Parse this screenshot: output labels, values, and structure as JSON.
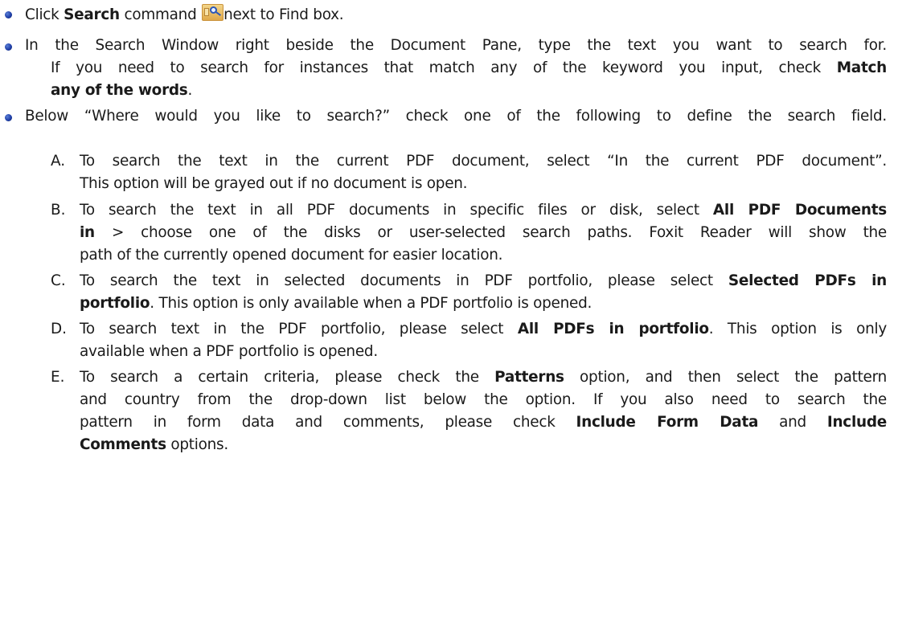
{
  "bullets": [
    {
      "pre": "Click ",
      "bold": "Search",
      "mid": " command ",
      "icon": "search-icon",
      "post": "next to Find box."
    },
    {
      "line1": "In the Search Window right beside the Document Pane, type the text you want to search for.",
      "line2_text": "If you need to search for instances that match any of the keyword you input, check ",
      "line2_bold": "Match",
      "line3_bold": "any of the words",
      "line3_text": "."
    },
    {
      "line1": "Below “Where would you like to search?” check one of the following to define the search field."
    }
  ],
  "options": [
    {
      "marker": "A.",
      "line1": "To search the text in the current PDF document, select “In the current PDF document”.",
      "line2": "This option will be grayed out if no document is open."
    },
    {
      "marker": "B.",
      "line1_text": "To search the text in all PDF documents in specific files or disk, select ",
      "line1_bold": "All PDF Documents",
      "line2_bold": "in",
      "line2_text": " > choose one of the disks or user-selected search paths. Foxit Reader will show the",
      "line3": "path of the currently opened document for easier location."
    },
    {
      "marker": "C.",
      "line1_text": "To search the text in selected documents in PDF portfolio, please select ",
      "line1_bold": "Selected PDFs in",
      "line2_bold": "portfolio",
      "line2_text": ". This option is only available when a PDF portfolio is opened."
    },
    {
      "marker": "D.",
      "line1_text": "To search text in the PDF portfolio, please select ",
      "line1_bold": "All PDFs in portfolio",
      "line1_tail": ". This option is only",
      "line2": "available when a PDF portfolio is opened."
    },
    {
      "marker": "E.",
      "line1_text": "To search a certain criteria, please check the ",
      "line1_bold": "Patterns",
      "line1_tail": " option, and then select the pattern",
      "line2": "and country from the drop-down list below the option. If you also need to search the",
      "line3_text": "pattern in form data and comments, please check ",
      "line3_bold1": "Include Form Data",
      "line3_mid": " and ",
      "line3_bold2": "Include",
      "line4_bold": "Comments",
      "line4_text": " options."
    }
  ]
}
